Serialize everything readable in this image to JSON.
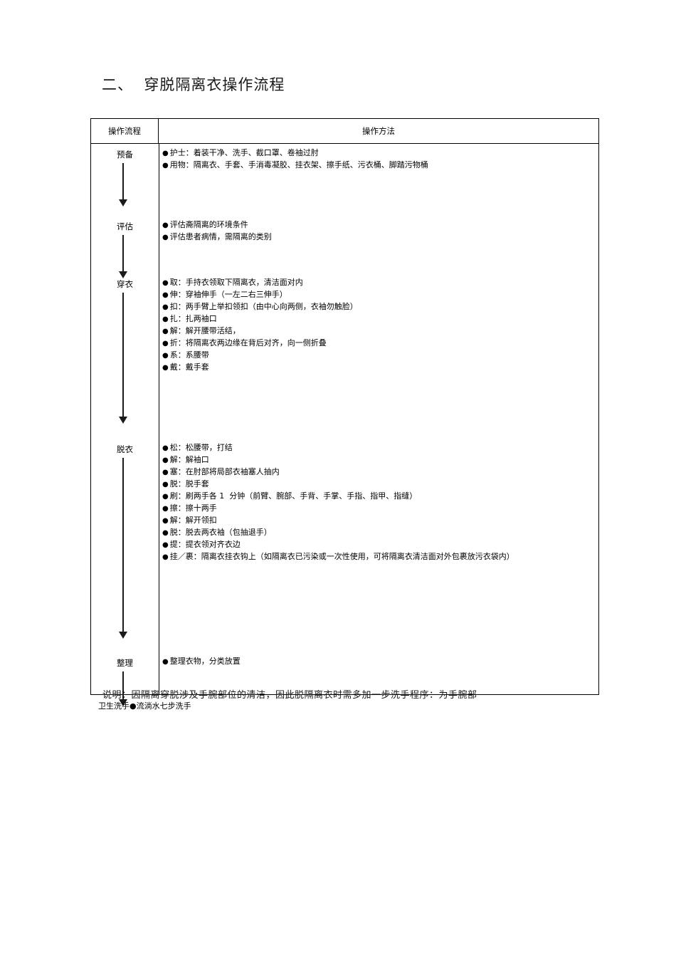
{
  "document": {
    "title": "二、  穿脱隔离衣操作流程",
    "note": "说明：因隔离穿脱涉及手腕部位的清洁，因此脱隔离衣时需多加一步洗手程序：为手腕部"
  },
  "table": {
    "headers": {
      "flow": "操作流程",
      "method": "操作方法"
    },
    "rows": [
      {
        "stage": "预备",
        "items": [
          "护士：着装干净、洗手、截口罩、卷袖过肘",
          "用物：隔离衣、手套、手消毒凝胶、挂衣架、擦手纸、污衣桶、脚踏污物桶"
        ]
      },
      {
        "stage": "评估",
        "items": [
          "评估斋隔离的环境条件",
          "评估患者病情，需隔离的类别"
        ]
      },
      {
        "stage": "穿衣",
        "items": [
          "取：手持衣领取下隔离衣，清洁面对内",
          "伸：穿袖伸手（一左二右三伸手）",
          "扣：两手臂上举扣领扣（由中心向两侧，衣袖勿触脸）",
          "扎：扎两袖口",
          "解：解开腰带活结，",
          "折：将隔离衣两边缘在背后对齐，向一侧折叠",
          "系：系腰带",
          "戴：戴手套"
        ]
      },
      {
        "stage": "脱衣",
        "items": [
          "松：松腰带，打结",
          "解：解袖口",
          "塞：在肘部将局部衣袖塞人抽内",
          "脱：脱手套",
          "刷：刷两手各 1  分钟（前臂、腕部、手背、手掌、手指、指甲、指缝）",
          "擦：擦十两手",
          "解：解开领扣",
          "脱：脱去两衣袖（包抽退手）",
          "提：提衣领对齐衣边",
          "挂／裹：隔离衣挂衣钩上（如隔离衣已污染或一次性使用，可将隔离衣清洁面对外包裹放污衣袋内）"
        ]
      },
      {
        "stage": "整理",
        "items": [
          "整理衣物，分类放置"
        ]
      }
    ],
    "footer_line": "卫生洗手●流淌水七步洗手"
  }
}
